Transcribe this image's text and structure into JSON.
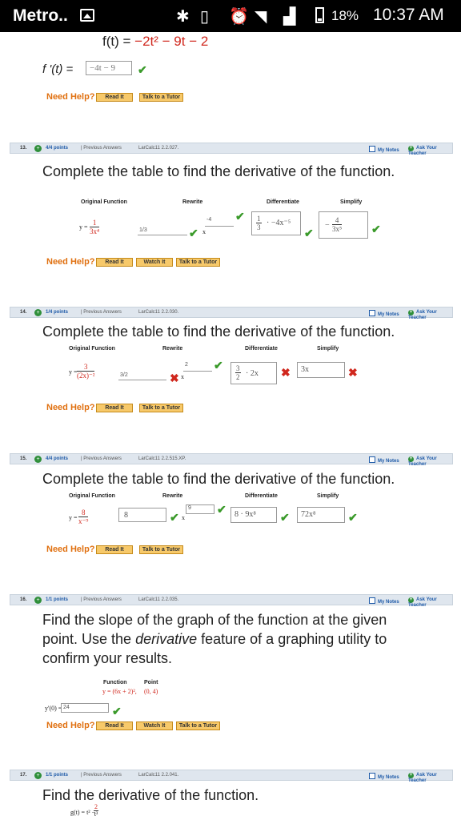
{
  "status_bar": {
    "carrier": "Metro..",
    "battery_percent": "18%",
    "time": "10:37 AM"
  },
  "top": {
    "function_prefix": "f(t) = ",
    "function_body": "−2t² − 9t − 2",
    "derivative_label": "f '(t) =",
    "derivative_answer": "−4t − 9",
    "need_help": "Need Help?",
    "read_it": "Read It",
    "talk_tutor": "Talk to a Tutor"
  },
  "q13": {
    "number": "13.",
    "points": "4/4 points",
    "previous_answers": "| Previous Answers",
    "reference": "LarCalc11 2.2.027.",
    "my_notes": "My Notes",
    "ask_teacher": "Ask Your Teacher",
    "prompt": "Complete the table to find the derivative of the function.",
    "headers": [
      "Original Function",
      "Rewrite",
      "Differentiate",
      "Simplify"
    ],
    "original_y": "y =",
    "original_num": "1",
    "original_den": "3x⁴",
    "rewrite_answer": "1/3",
    "rewrite_exponent": "-4",
    "rewrite_var": "x",
    "differentiate_answer_num": "1",
    "differentiate_answer_den": "3",
    "differentiate_rest": "· −4x⁻⁵",
    "simplify_sign": "−",
    "simplify_num": "4",
    "simplify_den": "3x⁵",
    "need_help": "Need Help?",
    "read_it": "Read It",
    "watch_it": "Watch It",
    "talk_tutor": "Talk to a Tutor"
  },
  "q14": {
    "number": "14.",
    "points": "1/4 points",
    "previous_answers": "| Previous Answers",
    "reference": "LarCalc11 2.2.030.",
    "my_notes": "My Notes",
    "ask_teacher": "Ask Your Teacher",
    "prompt": "Complete the table to find the derivative of the function.",
    "headers": [
      "Original Function",
      "Rewrite",
      "Differentiate",
      "Simplify"
    ],
    "original_y": "y =",
    "original_num": "3",
    "original_den": "(2x)⁻²",
    "rewrite_answer": "3/2",
    "rewrite_exponent": "2",
    "rewrite_var": "x",
    "differentiate_num": "3",
    "differentiate_den": "2",
    "differentiate_rest": "· 2x",
    "simplify_answer": "3x",
    "need_help": "Need Help?",
    "read_it": "Read It",
    "talk_tutor": "Talk to a Tutor"
  },
  "q15": {
    "number": "15.",
    "points": "4/4 points",
    "previous_answers": "| Previous Answers",
    "reference": "LarCalc11 2.2.515.XP.",
    "my_notes": "My Notes",
    "ask_teacher": "Ask Your Teacher",
    "prompt": "Complete the table to find the derivative of the function.",
    "headers": [
      "Original Function",
      "Rewrite",
      "Differentiate",
      "Simplify"
    ],
    "original_y": "y =",
    "original_num": "8",
    "original_den": "x⁻⁹",
    "rewrite_answer": "8",
    "rewrite_exponent": "9",
    "rewrite_var": "x",
    "differentiate_answer": "8 · 9x⁸",
    "simplify_answer": "72x⁸",
    "need_help": "Need Help?",
    "read_it": "Read It",
    "talk_tutor": "Talk to a Tutor"
  },
  "q16": {
    "number": "16.",
    "points": "1/1 points",
    "previous_answers": "| Previous Answers",
    "reference": "LarCalc11 2.2.035.",
    "my_notes": "My Notes",
    "ask_teacher": "Ask Your Teacher",
    "prompt_line1": "Find the slope of the graph of the function at the given",
    "prompt_line2_a": "point. Use the ",
    "prompt_line2_em": "derivative",
    "prompt_line2_b": " feature of a graphing utility to",
    "prompt_line3": "confirm your results.",
    "col_function": "Function",
    "col_point": "Point",
    "function_value": "y = (6x + 2)²,",
    "point_value": "(0, 4)",
    "answer_label": "y'(0) =",
    "answer_value": "24",
    "need_help": "Need Help?",
    "read_it": "Read It",
    "watch_it": "Watch It",
    "talk_tutor": "Talk to a Tutor"
  },
  "q17": {
    "number": "17.",
    "points": "1/1 points",
    "previous_answers": "| Previous Answers",
    "reference": "LarCalc11 2.2.041.",
    "my_notes": "My Notes",
    "ask_teacher": "Ask Your Teacher",
    "prompt": "Find the derivative of the function.",
    "function_partial": "g(t) = t² −",
    "function_frac_num": "2",
    "function_frac_den": "t³"
  }
}
